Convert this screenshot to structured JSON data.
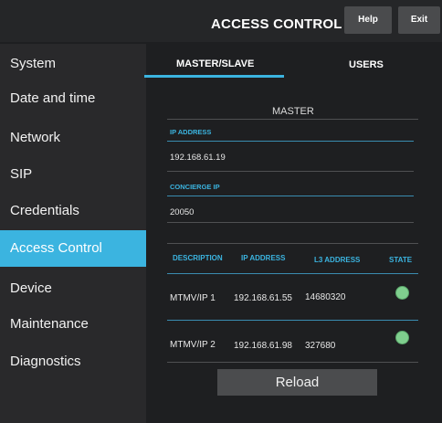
{
  "header": {
    "title": "ACCESS CONTROL",
    "help_label": "Help",
    "exit_label": "Exit"
  },
  "sidebar": {
    "items": [
      {
        "label": "System"
      },
      {
        "label": "Date and time"
      },
      {
        "label": "Network"
      },
      {
        "label": "SIP"
      },
      {
        "label": "Credentials"
      },
      {
        "label": "Access Control"
      },
      {
        "label": "Device"
      },
      {
        "label": "Maintenance"
      },
      {
        "label": "Diagnostics"
      }
    ]
  },
  "tabs": [
    {
      "label": "MASTER/SLAVE"
    },
    {
      "label": "USERS"
    }
  ],
  "master": {
    "section_title": "MASTER",
    "ip_label": "IP ADDRESS",
    "ip_value": "192.168.61.19",
    "concierge_label": "CONCIERGE IP",
    "concierge_value": "20050"
  },
  "table": {
    "headers": [
      "DESCRIPTION",
      "IP ADDRESS",
      "L3 ADDRESS",
      "STATE"
    ],
    "rows": [
      {
        "description": "MTMV/IP 1",
        "ip": "192.168.61.55",
        "l3": "14680320"
      },
      {
        "description": "MTMV/IP 2",
        "ip": "192.168.61.98",
        "l3": "327680"
      }
    ]
  },
  "reload_label": "Reload",
  "colors": {
    "accent": "#3bb4e0",
    "state_ok": "#7fcf8e"
  }
}
